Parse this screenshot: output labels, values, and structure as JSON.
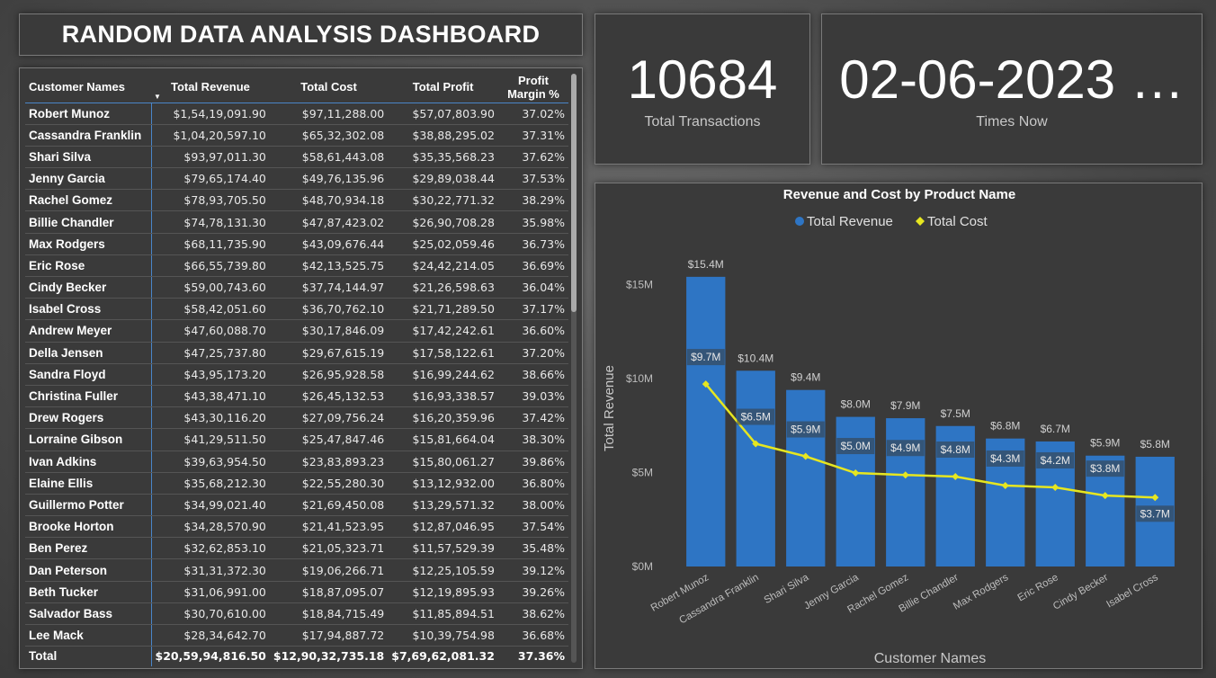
{
  "dashboard": {
    "title": "RANDOM DATA ANALYSIS DASHBOARD"
  },
  "cards": {
    "transactions": {
      "value": "10684",
      "label": "Total Transactions"
    },
    "time": {
      "value": "02-06-2023 …",
      "label": "Times Now"
    }
  },
  "table": {
    "headers": [
      "Customer Names",
      "Total Revenue",
      "Total Cost",
      "Total Profit",
      "Profit Margin %"
    ],
    "sorted_column": "Total Revenue",
    "rows": [
      [
        "Robert Munoz",
        "$1,54,19,091.90",
        "$97,11,288.00",
        "$57,07,803.90",
        "37.02%"
      ],
      [
        "Cassandra Franklin",
        "$1,04,20,597.10",
        "$65,32,302.08",
        "$38,88,295.02",
        "37.31%"
      ],
      [
        "Shari Silva",
        "$93,97,011.30",
        "$58,61,443.08",
        "$35,35,568.23",
        "37.62%"
      ],
      [
        "Jenny Garcia",
        "$79,65,174.40",
        "$49,76,135.96",
        "$29,89,038.44",
        "37.53%"
      ],
      [
        "Rachel Gomez",
        "$78,93,705.50",
        "$48,70,934.18",
        "$30,22,771.32",
        "38.29%"
      ],
      [
        "Billie Chandler",
        "$74,78,131.30",
        "$47,87,423.02",
        "$26,90,708.28",
        "35.98%"
      ],
      [
        "Max Rodgers",
        "$68,11,735.90",
        "$43,09,676.44",
        "$25,02,059.46",
        "36.73%"
      ],
      [
        "Eric Rose",
        "$66,55,739.80",
        "$42,13,525.75",
        "$24,42,214.05",
        "36.69%"
      ],
      [
        "Cindy Becker",
        "$59,00,743.60",
        "$37,74,144.97",
        "$21,26,598.63",
        "36.04%"
      ],
      [
        "Isabel Cross",
        "$58,42,051.60",
        "$36,70,762.10",
        "$21,71,289.50",
        "37.17%"
      ],
      [
        "Andrew Meyer",
        "$47,60,088.70",
        "$30,17,846.09",
        "$17,42,242.61",
        "36.60%"
      ],
      [
        "Della Jensen",
        "$47,25,737.80",
        "$29,67,615.19",
        "$17,58,122.61",
        "37.20%"
      ],
      [
        "Sandra Floyd",
        "$43,95,173.20",
        "$26,95,928.58",
        "$16,99,244.62",
        "38.66%"
      ],
      [
        "Christina Fuller",
        "$43,38,471.10",
        "$26,45,132.53",
        "$16,93,338.57",
        "39.03%"
      ],
      [
        "Drew Rogers",
        "$43,30,116.20",
        "$27,09,756.24",
        "$16,20,359.96",
        "37.42%"
      ],
      [
        "Lorraine Gibson",
        "$41,29,511.50",
        "$25,47,847.46",
        "$15,81,664.04",
        "38.30%"
      ],
      [
        "Ivan Adkins",
        "$39,63,954.50",
        "$23,83,893.23",
        "$15,80,061.27",
        "39.86%"
      ],
      [
        "Elaine Ellis",
        "$35,68,212.30",
        "$22,55,280.30",
        "$13,12,932.00",
        "36.80%"
      ],
      [
        "Guillermo Potter",
        "$34,99,021.40",
        "$21,69,450.08",
        "$13,29,571.32",
        "38.00%"
      ],
      [
        "Brooke Horton",
        "$34,28,570.90",
        "$21,41,523.95",
        "$12,87,046.95",
        "37.54%"
      ],
      [
        "Ben Perez",
        "$32,62,853.10",
        "$21,05,323.71",
        "$11,57,529.39",
        "35.48%"
      ],
      [
        "Dan Peterson",
        "$31,31,372.30",
        "$19,06,266.71",
        "$12,25,105.59",
        "39.12%"
      ],
      [
        "Beth Tucker",
        "$31,06,991.00",
        "$18,87,095.07",
        "$12,19,895.93",
        "39.26%"
      ],
      [
        "Salvador Bass",
        "$30,70,610.00",
        "$18,84,715.49",
        "$11,85,894.51",
        "38.62%"
      ],
      [
        "Lee Mack",
        "$28,34,642.70",
        "$17,94,887.72",
        "$10,39,754.98",
        "36.68%"
      ]
    ],
    "total": [
      "Total",
      "$20,59,94,816.50",
      "$12,90,32,735.18",
      "$7,69,62,081.32",
      "37.36%"
    ]
  },
  "chart_data": {
    "type": "bar",
    "title": "Revenue and Cost by Product Name",
    "xlabel": "Customer Names",
    "ylabel": "Total Revenue",
    "ylim": [
      0,
      16800000
    ],
    "yticks": [
      {
        "value": 0,
        "label": "$0M"
      },
      {
        "value": 5000000,
        "label": "$5M"
      },
      {
        "value": 10000000,
        "label": "$10M"
      },
      {
        "value": 15000000,
        "label": "$15M"
      }
    ],
    "legend": "top-center",
    "categories": [
      "Robert Munoz",
      "Cassandra Franklin",
      "Shari Silva",
      "Jenny Garcia",
      "Rachel Gomez",
      "Billie Chandler",
      "Max Rodgers",
      "Eric Rose",
      "Cindy Becker",
      "Isabel Cross"
    ],
    "series": [
      {
        "name": "Total Revenue",
        "kind": "bar",
        "color": "#2e75c4",
        "values": [
          15419091.9,
          10420597.1,
          9397011.3,
          7965174.4,
          7893705.5,
          7478131.3,
          6811735.9,
          6655739.8,
          5900743.6,
          5842051.6
        ],
        "labels": [
          "$15.4M",
          "$10.4M",
          "$9.4M",
          "$8.0M",
          "$7.9M",
          "$7.5M",
          "$6.8M",
          "$6.7M",
          "$5.9M",
          "$5.8M"
        ]
      },
      {
        "name": "Total Cost",
        "kind": "line",
        "color": "#e6e620",
        "values": [
          9711288.0,
          6532302.08,
          5861443.08,
          4976135.96,
          4870934.18,
          4787423.02,
          4309676.44,
          4213525.75,
          3774144.97,
          3670762.1
        ],
        "labels": [
          "$9.7M",
          "$6.5M",
          "$5.9M",
          "$5.0M",
          "$4.9M",
          "$4.8M",
          "$4.3M",
          "$4.2M",
          "$3.8M",
          "$3.7M"
        ]
      }
    ]
  }
}
